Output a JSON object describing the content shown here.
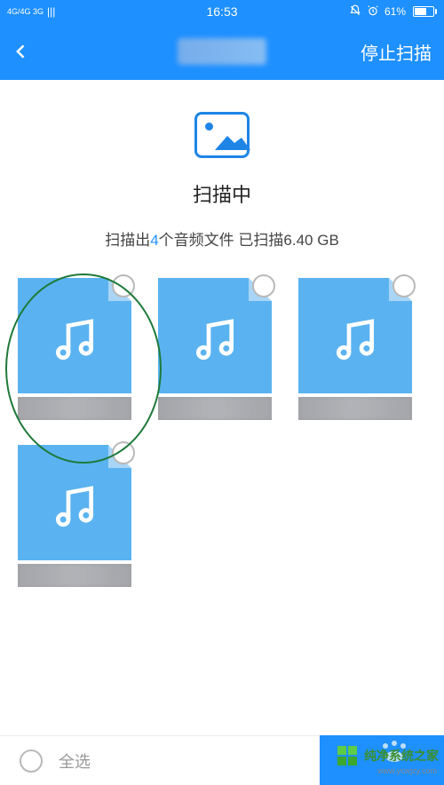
{
  "status": {
    "network": "4G/4G  3G",
    "signal": "|||",
    "time": "16:53",
    "alarm": true,
    "mute": true,
    "battery_pct": "61%"
  },
  "header": {
    "stop_scan": "停止扫描"
  },
  "scan": {
    "title": "扫描中",
    "prefix": "扫描出",
    "count": "4",
    "middle": "个音频文件 已扫描",
    "size": "6.40 GB"
  },
  "footer": {
    "select_all": "全选"
  },
  "watermark": {
    "brand": "纯净系统之家",
    "url": "www.ycwjzy.com"
  },
  "icons": {
    "back": "back-chevron",
    "photo": "photo-placeholder",
    "music": "music-note",
    "bell": "bell-off",
    "alarm": "alarm-clock"
  },
  "colors": {
    "primary": "#1e90ff",
    "file": "#5ab3f0",
    "highlight": "#1f7a3a"
  }
}
